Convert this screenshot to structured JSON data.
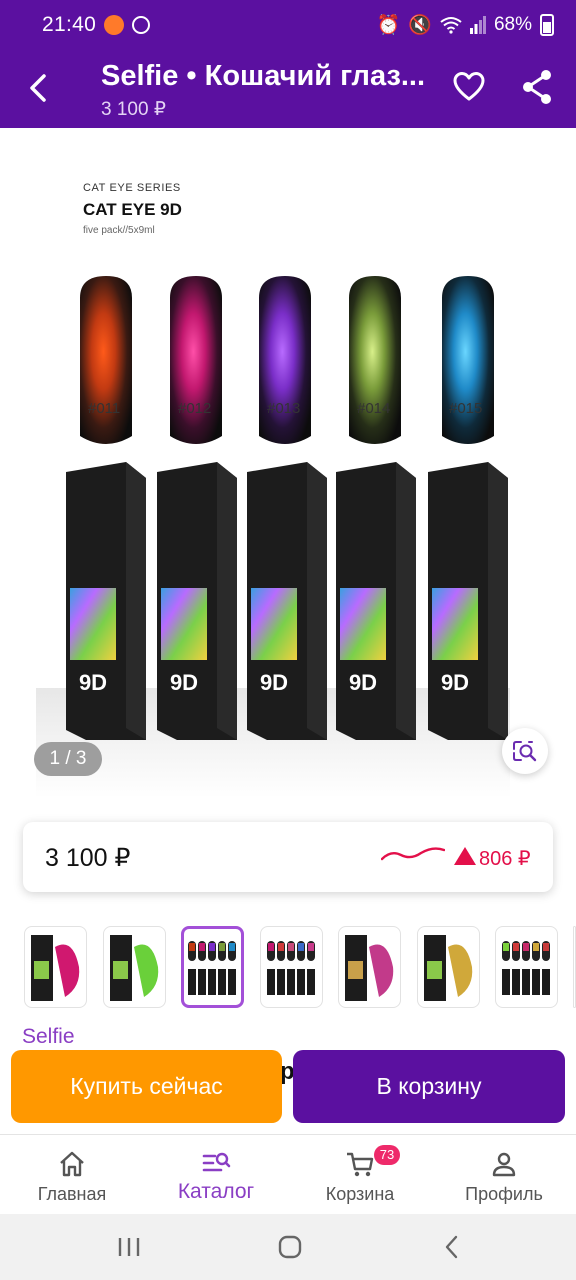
{
  "status_bar": {
    "time": "21:40",
    "battery": "68%"
  },
  "header": {
    "title": "Selfie • Кошачий глаз...",
    "subtitle": "3 100 ₽"
  },
  "product_image": {
    "series_label": "CAT EYE SERIES",
    "product_name": "CAT EYE 9D",
    "pack_info": "five pack//5x9ml",
    "shade_labels": [
      "#011",
      "#012",
      "#013",
      "#014",
      "#015"
    ],
    "bottle_print": "9D"
  },
  "gallery": {
    "page_indicator": "1 / 3"
  },
  "price": {
    "current": "3 100 ₽",
    "change": "806 ₽",
    "trend_color": "#e3104a"
  },
  "brand": "Selfie",
  "actions": {
    "buy_now": "Купить сейчас",
    "add_to_cart": "В корзину",
    "obscured_text": "р"
  },
  "bottom_nav": {
    "items": [
      {
        "label": "Главная",
        "icon": "home-icon"
      },
      {
        "label": "Каталог",
        "icon": "catalog-icon"
      },
      {
        "label": "Корзина",
        "icon": "cart-icon",
        "badge": "73"
      },
      {
        "label": "Профиль",
        "icon": "profile-icon"
      }
    ],
    "active": "Каталог"
  },
  "colors": {
    "brand_purple": "#5b10a0",
    "accent_orange": "#ff9800",
    "accent_pink": "#e3104a"
  }
}
